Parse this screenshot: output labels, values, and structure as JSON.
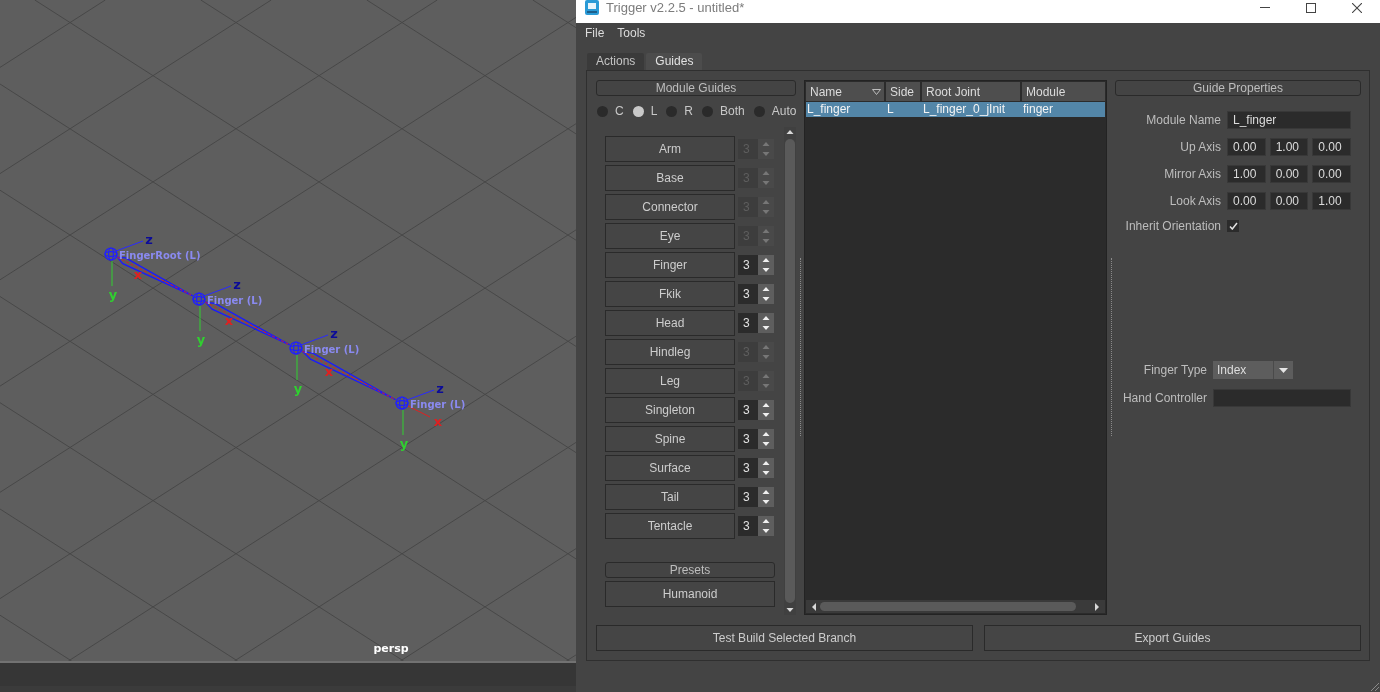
{
  "viewport": {
    "joints": [
      {
        "label": "FingerRoot (L)",
        "axes": [
          "z",
          "y",
          "x"
        ]
      },
      {
        "label": "Finger (L)",
        "axes": [
          "z",
          "y",
          "x"
        ]
      },
      {
        "label": "Finger (L)",
        "axes": [
          "z",
          "y",
          "x"
        ]
      },
      {
        "label": "Finger (L)",
        "axes": [
          "z",
          "y",
          "x"
        ]
      }
    ],
    "camera": "persp"
  },
  "window": {
    "title": "Trigger v2.2.5 - untitled*"
  },
  "menu": [
    "File",
    "Tools"
  ],
  "tabs": [
    {
      "label": "Actions",
      "selected": false
    },
    {
      "label": "Guides",
      "selected": true
    }
  ],
  "module_guides": {
    "title": "Module Guides",
    "sides": [
      {
        "label": "C",
        "selected": false
      },
      {
        "label": "L",
        "selected": true
      },
      {
        "label": "R",
        "selected": false
      },
      {
        "label": "Both",
        "selected": false
      },
      {
        "label": "Auto",
        "selected": false
      }
    ],
    "modules": [
      {
        "label": "Arm",
        "count": {
          "value": "3",
          "disabled": true
        }
      },
      {
        "label": "Base",
        "count": {
          "value": "3",
          "disabled": true
        }
      },
      {
        "label": "Connector",
        "count": {
          "value": "3",
          "disabled": true
        }
      },
      {
        "label": "Eye",
        "count": {
          "value": "3",
          "disabled": true
        }
      },
      {
        "label": "Finger",
        "count": {
          "value": "3",
          "disabled": false
        }
      },
      {
        "label": "Fkik",
        "count": {
          "value": "3",
          "disabled": false
        }
      },
      {
        "label": "Head",
        "count": {
          "value": "3",
          "disabled": false
        }
      },
      {
        "label": "Hindleg",
        "count": {
          "value": "3",
          "disabled": true
        }
      },
      {
        "label": "Leg",
        "count": {
          "value": "3",
          "disabled": true
        }
      },
      {
        "label": "Singleton",
        "count": {
          "value": "3",
          "disabled": false
        }
      },
      {
        "label": "Spine",
        "count": {
          "value": "3",
          "disabled": false
        }
      },
      {
        "label": "Surface",
        "count": {
          "value": "3",
          "disabled": false
        }
      },
      {
        "label": "Tail",
        "count": {
          "value": "3",
          "disabled": false
        }
      },
      {
        "label": "Tentacle",
        "count": {
          "value": "3",
          "disabled": false
        }
      }
    ],
    "presets_title": "Presets",
    "presets": [
      "Humanoid"
    ]
  },
  "guides_table": {
    "columns": [
      {
        "label": "Name",
        "sorted": true
      },
      {
        "label": "Side",
        "sorted": false
      },
      {
        "label": "Root Joint",
        "sorted": false
      },
      {
        "label": "Module",
        "sorted": false
      }
    ],
    "rows": [
      {
        "cells": [
          "L_finger",
          "L",
          "L_finger_0_jInit",
          "finger"
        ],
        "selected": true
      }
    ]
  },
  "guide_properties": {
    "title": "Guide Properties",
    "fields": [
      {
        "kind": "text",
        "label": "Module Name",
        "value": "L_finger"
      },
      {
        "kind": "vector",
        "label": "Up Axis",
        "values": [
          "0.00",
          "1.00",
          "0.00"
        ]
      },
      {
        "kind": "vector",
        "label": "Mirror Axis",
        "values": [
          "1.00",
          "0.00",
          "0.00"
        ]
      },
      {
        "kind": "vector",
        "label": "Look Axis",
        "values": [
          "0.00",
          "0.00",
          "1.00"
        ]
      },
      {
        "kind": "checkbox",
        "label": "Inherit Orientation",
        "checked": true
      }
    ],
    "module_fields": [
      {
        "kind": "dropdown",
        "label": "Finger Type",
        "value": "Index"
      },
      {
        "kind": "text",
        "label": "Hand Controller"
      }
    ]
  },
  "actions": [
    "Test Build Selected Branch",
    "Export Guides"
  ]
}
